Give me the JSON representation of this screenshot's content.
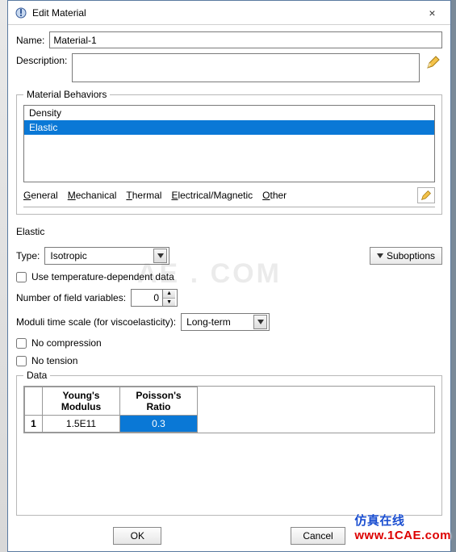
{
  "window": {
    "title": "Edit Material",
    "close_icon": "×"
  },
  "fields": {
    "name_label": "Name:",
    "name_value": "Material-1",
    "desc_label": "Description:",
    "desc_value": ""
  },
  "behaviors": {
    "legend": "Material Behaviors",
    "items": [
      "Density",
      "Elastic"
    ],
    "selected_index": 1
  },
  "menus": {
    "general": "General",
    "mechanical": "Mechanical",
    "thermal": "Thermal",
    "electrical": "Electrical/Magnetic",
    "other": "Other"
  },
  "elastic": {
    "heading": "Elastic",
    "type_label": "Type:",
    "type_value": "Isotropic",
    "suboptions_label": "Suboptions",
    "use_temp_label": "Use temperature-dependent data",
    "use_temp_checked": false,
    "field_vars_label": "Number of field variables:",
    "field_vars_value": "0",
    "moduli_label": "Moduli time scale (for viscoelasticity):",
    "moduli_value": "Long-term",
    "no_compression_label": "No compression",
    "no_compression_checked": false,
    "no_tension_label": "No tension",
    "no_tension_checked": false
  },
  "data": {
    "legend": "Data",
    "columns": [
      "Young's\nModulus",
      "Poisson's\nRatio"
    ],
    "rows": [
      {
        "index": "1",
        "values": [
          "1.5E11",
          "0.3"
        ],
        "selected_col": 1
      }
    ]
  },
  "buttons": {
    "ok": "OK",
    "cancel": "Cancel"
  },
  "watermark": {
    "cn": "仿真在线",
    "url": "www.1CAE.com"
  }
}
